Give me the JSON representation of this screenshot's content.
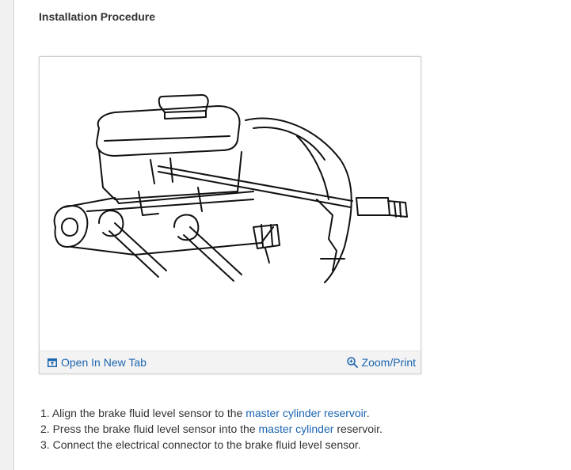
{
  "section": {
    "heading": "Installation Procedure"
  },
  "figure": {
    "open_tab_label": "Open In New Tab",
    "zoom_label": "Zoom/Print",
    "icons": [
      "open-in-new-tab-icon",
      "zoom-icon"
    ]
  },
  "steps": [
    {
      "num": "1.",
      "text_before": "Align the brake fluid level sensor to the",
      "link": "master cylinder reservoir",
      "text_after": "."
    },
    {
      "num": "2.",
      "text_before": "Press the brake fluid level sensor into the",
      "link": "master cylinder",
      "text_after": "reservoir."
    },
    {
      "num": "3.",
      "text": "Connect the electrical connector to the brake fluid level sensor."
    }
  ],
  "colors": {
    "link": "#1a64b0",
    "text": "#333333",
    "bar_bg": "#f3f3f3"
  }
}
